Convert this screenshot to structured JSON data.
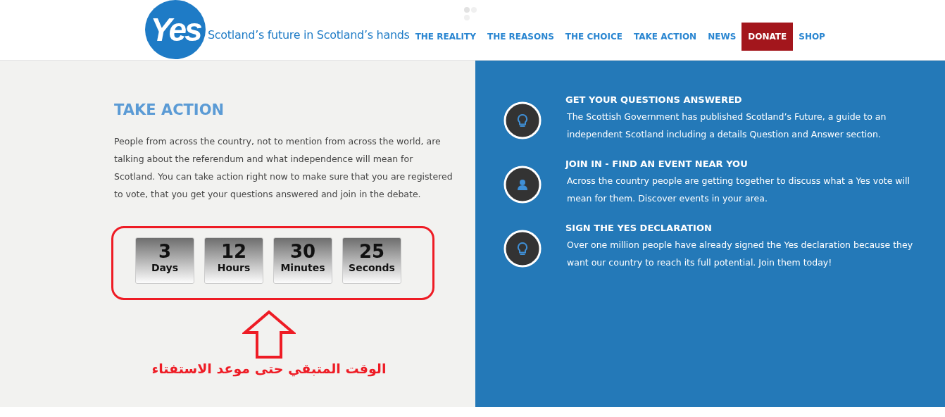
{
  "header": {
    "logo": "Yes",
    "tagline": "Scotland’s future in Scotland’s hands",
    "nav": [
      {
        "label": "THE REALITY",
        "kind": "link"
      },
      {
        "label": "THE REASONS",
        "kind": "link"
      },
      {
        "label": "THE CHOICE",
        "kind": "link"
      },
      {
        "label": "TAKE ACTION",
        "kind": "link"
      },
      {
        "label": "NEWS",
        "kind": "link"
      },
      {
        "label": "DONATE",
        "kind": "button"
      },
      {
        "label": "SHOP",
        "kind": "link"
      }
    ]
  },
  "intro": {
    "title": "TAKE ACTION",
    "text": "People from across the country, not to mention from across the world, are talking about the referendum and what independence will mean for Scotland. You can take action right now to make sure that you are registered to vote, that you get your questions answered and join in the debate."
  },
  "countdown": [
    {
      "value": "3",
      "unit": "Days"
    },
    {
      "value": "12",
      "unit": "Hours"
    },
    {
      "value": "30",
      "unit": "Minutes"
    },
    {
      "value": "25",
      "unit": "Seconds"
    }
  ],
  "annotation": {
    "caption": "الوقت المتبقي حتى موعد الاستفتاء"
  },
  "features": [
    {
      "kind": "bulb",
      "title": "GET YOUR QUESTIONS ANSWERED",
      "text": "The Scottish Government has published Scotland’s Future, a guide to an independent Scotland including a details Question and Answer section."
    },
    {
      "kind": "person",
      "title": "JOIN IN - FIND AN EVENT NEAR YOU",
      "text": "Across the country people are getting together to discuss what a Yes vote will mean for them. Discover events in your area."
    },
    {
      "kind": "bulb",
      "title": "SIGN THE YES DECLARATION",
      "text": "Over one million people have already signed the Yes declaration because they want our country to reach its full potential. Join them today!"
    }
  ]
}
